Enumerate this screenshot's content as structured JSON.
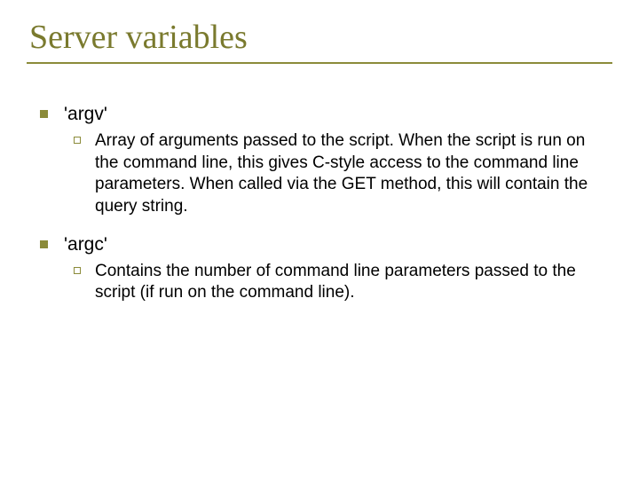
{
  "title": "Server variables",
  "items": [
    {
      "label": "'argv'",
      "sub": [
        {
          "text": "Array of arguments passed to the script. When the script is run on the command line, this gives C-style access to the command line parameters. When called via the GET method, this will contain the query string."
        }
      ]
    },
    {
      "label": "'argc'",
      "sub": [
        {
          "text": "Contains the number of command line parameters passed to the script (if run on the command line)."
        }
      ]
    }
  ]
}
